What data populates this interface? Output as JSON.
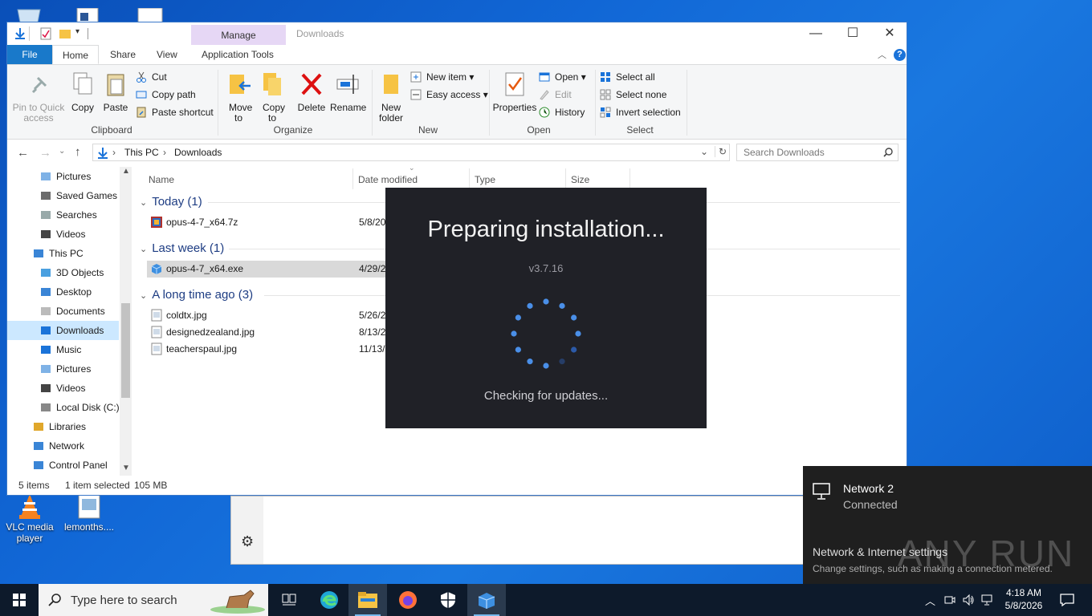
{
  "desktop": {
    "icons": [
      {
        "label": "VLC media player"
      },
      {
        "label": "lemonths...."
      }
    ]
  },
  "explorer": {
    "title": "Downloads",
    "context_tab_header": "Manage",
    "tabs": {
      "file": "File",
      "home": "Home",
      "share": "Share",
      "view": "View",
      "app_tools": "Application Tools"
    },
    "ribbon": {
      "clipboard": {
        "label": "Clipboard",
        "pin": "Pin to Quick access",
        "copy": "Copy",
        "paste": "Paste",
        "cut": "Cut",
        "copy_path": "Copy path",
        "paste_shortcut": "Paste shortcut"
      },
      "organize": {
        "label": "Organize",
        "move_to": "Move to",
        "copy_to": "Copy to",
        "delete": "Delete",
        "rename": "Rename"
      },
      "new": {
        "label": "New",
        "new_folder": "New folder",
        "new_item": "New item",
        "easy_access": "Easy access"
      },
      "open": {
        "label": "Open",
        "properties": "Properties",
        "open": "Open",
        "edit": "Edit",
        "history": "History"
      },
      "select": {
        "label": "Select",
        "select_all": "Select all",
        "select_none": "Select none",
        "invert": "Invert selection"
      }
    },
    "address": {
      "crumbs": [
        "This PC",
        "Downloads"
      ],
      "search_placeholder": "Search Downloads"
    },
    "nav": [
      "Pictures",
      "Saved Games",
      "Searches",
      "Videos",
      "This PC",
      "3D Objects",
      "Desktop",
      "Documents",
      "Downloads",
      "Music",
      "Pictures",
      "Videos",
      "Local Disk (C:)",
      "Libraries",
      "Network",
      "Control Panel"
    ],
    "columns": {
      "name": "Name",
      "date": "Date modified",
      "type": "Type",
      "size": "Size"
    },
    "groups": [
      {
        "label": "Today (1)",
        "files": [
          {
            "name": "opus-4-7_x64.7z",
            "date": "5/8/20"
          }
        ]
      },
      {
        "label": "Last week (1)",
        "files": [
          {
            "name": "opus-4-7_x64.exe",
            "date": "4/29/2"
          }
        ]
      },
      {
        "label": "A long time ago (3)",
        "files": [
          {
            "name": "coldtx.jpg",
            "date": "5/26/2"
          },
          {
            "name": "designedzealand.jpg",
            "date": "8/13/2"
          },
          {
            "name": "teacherspaul.jpg",
            "date": "11/13/"
          }
        ]
      }
    ],
    "status": {
      "items": "5 items",
      "selected": "1 item selected",
      "size": "105 MB"
    }
  },
  "installer": {
    "title": "Preparing installation...",
    "version": "v3.7.16",
    "status": "Checking for updates..."
  },
  "network_flyout": {
    "name": "Network 2",
    "state": "Connected",
    "settings_link": "Network & Internet settings",
    "settings_desc": "Change settings, such as making a connection metered."
  },
  "watermark": "ANY RUN",
  "taskbar": {
    "search_placeholder": "Type here to search",
    "time": "4:18 AM",
    "date": "5/8/2026"
  }
}
